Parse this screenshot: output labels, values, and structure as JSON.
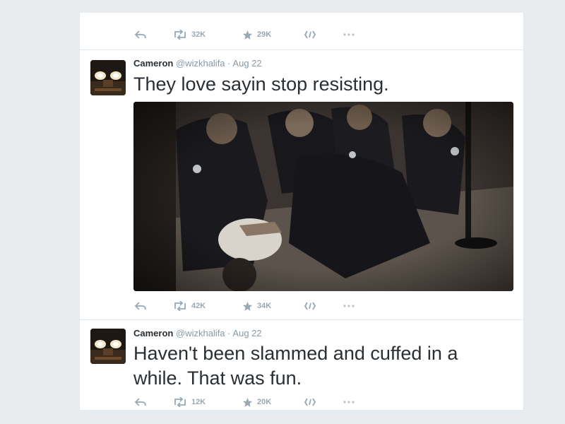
{
  "tweets": [
    {
      "actions": {
        "retweets": "32K",
        "favorites": "29K"
      }
    },
    {
      "name": "Cameron",
      "handle": "@wizkhalifa",
      "separator": "·",
      "date": "Aug 22",
      "text": "They love sayin stop resisting.",
      "actions": {
        "retweets": "42K",
        "favorites": "34K"
      }
    },
    {
      "name": "Cameron",
      "handle": "@wizkhalifa",
      "separator": "·",
      "date": "Aug 22",
      "text_line1": "Haven't been slammed and cuffed in a",
      "text_line2": "while. That was fun.",
      "actions": {
        "retweets": "12K",
        "favorites": "20K"
      }
    }
  ],
  "icons": {
    "reply": "reply-icon",
    "retweet": "retweet-icon",
    "favorite": "star-icon",
    "pocket": "pocket-icon",
    "more": "more-icon"
  },
  "colors": {
    "name": "#292f33",
    "meta": "#8899a6",
    "action": "#9aa8b4",
    "border": "#e1e8ed"
  }
}
